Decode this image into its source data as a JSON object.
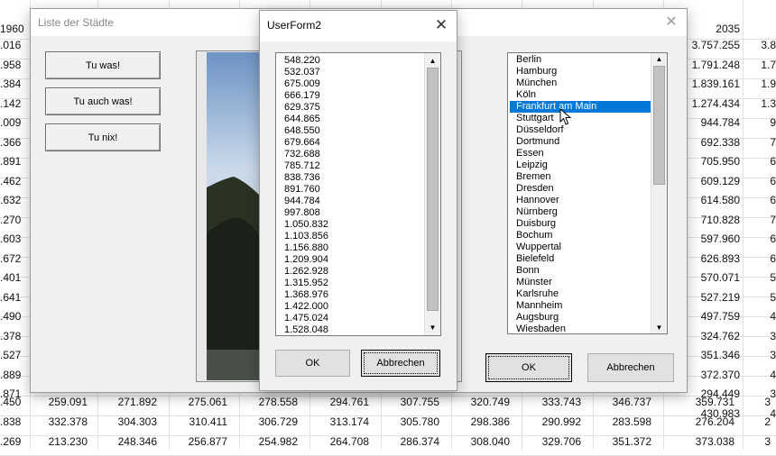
{
  "sheet": {
    "header_values": [
      "1960",
      "2035"
    ],
    "left_column": [
      ".016",
      ".958",
      ".384",
      ".142",
      ".009",
      ".366",
      ".891",
      ".462",
      ".632",
      ".270",
      ".603",
      ".672",
      ".401",
      ".641",
      ".490",
      ".378",
      ".527",
      ".889",
      ".871"
    ],
    "right_column": [
      "3.757.255",
      "1.791.248",
      "1.839.161",
      "1.274.434",
      "944.784",
      "692.338",
      "705.950",
      "609.129",
      "614.580",
      "710.828",
      "597.960",
      "626.893",
      "570.071",
      "527.219",
      "497.759",
      "324.762",
      "351.346",
      "372.370",
      "294.449",
      "430.983"
    ],
    "edge_column": [
      "3.8",
      "1.7",
      "1.9",
      "1.3",
      "9",
      "7",
      "6",
      "6",
      "6",
      "7",
      "6",
      "6",
      "5",
      "5",
      "4",
      "3",
      "3",
      "4",
      "3",
      "4"
    ],
    "bottom_rows": [
      [
        ".450",
        "259.091",
        "271.892",
        "275.061",
        "278.558",
        "294.761",
        "307.755",
        "320.749",
        "333.743",
        "346.737",
        "359.731",
        "3"
      ],
      [
        ".838",
        "332.378",
        "304.303",
        "310.411",
        "306.729",
        "313.174",
        "305.780",
        "298.386",
        "290.992",
        "283.598",
        "276.204",
        "2"
      ],
      [
        ".269",
        "213.230",
        "248.346",
        "256.877",
        "254.982",
        "264.708",
        "286.374",
        "308.040",
        "329.706",
        "351.372",
        "373.038",
        "3"
      ]
    ]
  },
  "main_form": {
    "title": "Liste der Städte",
    "buttons": [
      "Tu was!",
      "Tu auch was!",
      "Tu nix!"
    ],
    "cities": [
      "Berlin",
      "Hamburg",
      "München",
      "Köln",
      "Frankfurt am Main",
      "Stuttgart",
      "Düsseldorf",
      "Dortmund",
      "Essen",
      "Leipzig",
      "Bremen",
      "Dresden",
      "Hannover",
      "Nürnberg",
      "Duisburg",
      "Bochum",
      "Wuppertal",
      "Bielefeld",
      "Bonn",
      "Münster",
      "Karlsruhe",
      "Mannheim",
      "Augsburg",
      "Wiesbaden"
    ],
    "selected_city": "Frankfurt am Main",
    "ok_label": "OK",
    "cancel_label": "Abbrechen"
  },
  "userform2": {
    "title": "UserForm2",
    "values": [
      "548.220",
      "532.037",
      "675.009",
      "666.179",
      "629.375",
      "644.865",
      "648.550",
      "679.664",
      "732.688",
      "785.712",
      "838.736",
      "891.760",
      "944.784",
      "997.808",
      "1.050.832",
      "1.103.856",
      "1.156.880",
      "1.209.904",
      "1.262.928",
      "1.315.952",
      "1.368.976",
      "1.422.000",
      "1.475.024",
      "1.528.048"
    ],
    "ok_label": "OK",
    "cancel_label": "Abbrechen"
  },
  "colors": {
    "selection": "#0078d7",
    "dialog_bg": "#f0f0f0"
  },
  "icons": {
    "close": "close-icon",
    "scroll_up": "scroll-up-icon",
    "scroll_down": "scroll-down-icon",
    "cursor": "mouse-cursor-icon"
  }
}
